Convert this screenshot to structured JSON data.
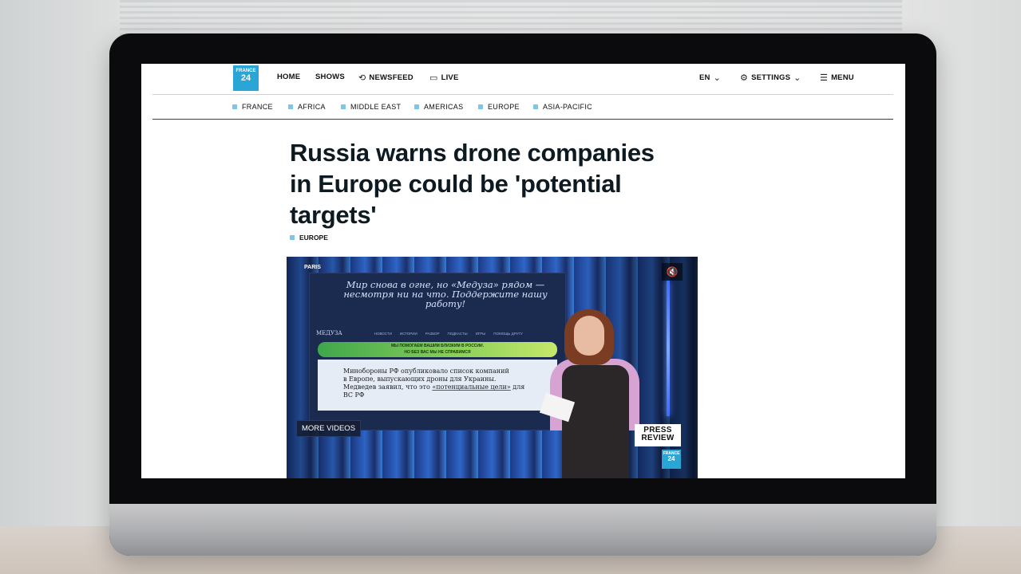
{
  "logo": {
    "line1": "FRANCE",
    "line2": "24"
  },
  "topnav": {
    "home": "HOME",
    "shows": "SHOWS",
    "newsfeed": "NEWSFEED",
    "live": "LIVE",
    "language": "EN",
    "settings": "SETTINGS",
    "menu": "MENU"
  },
  "regions": [
    "FRANCE",
    "AFRICA",
    "MIDDLE EAST",
    "AMERICAS",
    "EUROPE",
    "ASIA-PACIFIC"
  ],
  "article": {
    "headline": "Russia warns drone companies in Europe could be 'potential targets'",
    "tag": "EUROPE"
  },
  "video": {
    "location": "PARIS",
    "more_videos": "MORE VIDEOS",
    "press_line1": "PRESS",
    "press_line2": "REVIEW",
    "screen_title": "Мир снова в огне, но «Медуза» рядом — несмотря ни на что. Поддержите нашу работу!",
    "screen_logo": "МЕДУЗА",
    "screen_menu": [
      "НОВОСТИ",
      "ИСТОРИИ",
      "РАЗБОР",
      "ПОДКАСТЫ",
      "ИГРЫ",
      "ПОМОЩЬ ДРУГУ"
    ],
    "screen_banner_line1": "МЫ ПОМОГАЕМ ВАШИМ БЛИЗКИМ В РОССИИ.",
    "screen_banner_line2": "НО БЕЗ ВАС МЫ НЕ СПРАВИМСЯ",
    "screen_text_1": "Минобороны РФ опубликовало список компаний",
    "screen_text_2": "в Европе, выпускающих дроны для Украины.",
    "screen_text_3": "Медведев заявил, что это",
    "screen_text_underlined": "«потенциальные цели»",
    "screen_text_4": "для",
    "screen_text_5": "ВС РФ",
    "vlogo_line1": "FRANCE",
    "vlogo_line2": "24"
  }
}
